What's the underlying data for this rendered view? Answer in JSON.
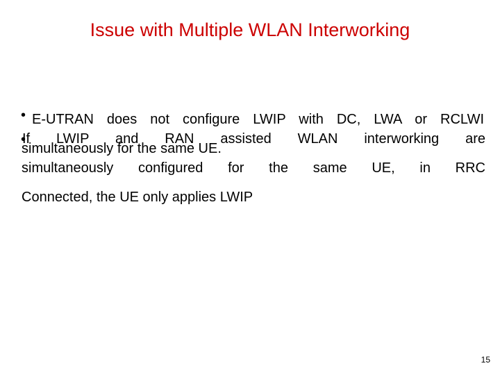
{
  "title": "Issue with Multiple WLAN Interworking",
  "bullets": [
    {
      "symbol": "•",
      "lines": [
        "E-UTRAN does not configure LWIP with DC, LWA or RCLWI",
        "simultaneously for the same UE."
      ]
    },
    {
      "symbol": "•",
      "lines": [
        "If LWIP and RAN assisted WLAN interworking are",
        "simultaneously configured for the same UE, in RRC",
        "Connected, the UE only applies LWIP"
      ]
    }
  ],
  "page_number": "15",
  "colors": {
    "title": "#cc0000",
    "text": "#000000"
  }
}
